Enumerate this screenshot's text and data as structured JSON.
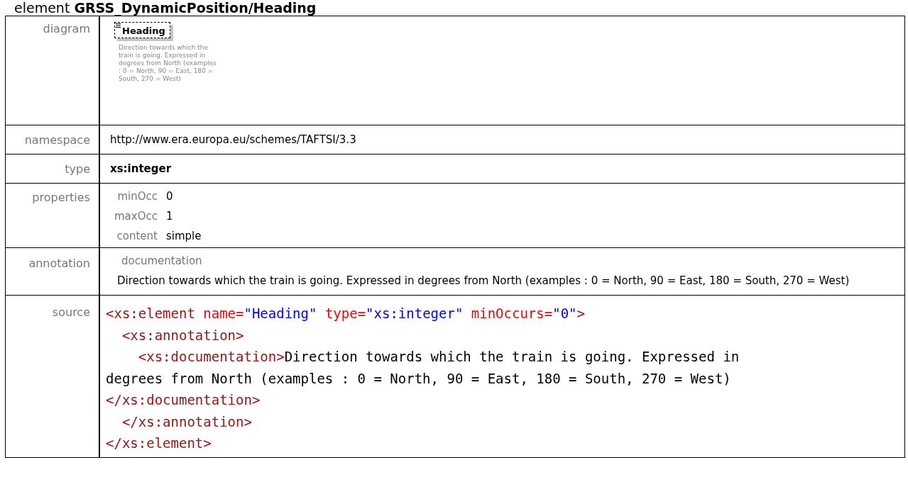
{
  "title": "element **GRSS_DynamicPosition/Heading**",
  "rows": [
    {
      "kind": "diagram",
      "label": "diagram",
      "element_name": "Heading",
      "description": "Direction towards which the train is going. Expressed in degrees from North (examples : 0 = North, 90 = East, 180 = South, 270 = West)"
    },
    {
      "kind": "text",
      "label": "namespace",
      "value": "http://www.era.europa.eu/schemes/TAFTSI/3.3"
    },
    {
      "kind": "bold",
      "label": "type",
      "value": "xs:integer"
    },
    {
      "kind": "properties",
      "label": "properties",
      "items": [
        {
          "name": "minOcc",
          "value": "0"
        },
        {
          "name": "maxOcc",
          "value": "1"
        },
        {
          "name": "content",
          "value": "simple"
        }
      ]
    },
    {
      "kind": "annotation",
      "label": "annotation",
      "heading": "documentation",
      "text": "Direction towards which the train is going. Expressed in degrees from North (examples : 0 = North, 90 = East, 180 = South, 270 = West)"
    },
    {
      "kind": "source",
      "label": "source",
      "lines": [
        {
          "open": [
            {
              "kind": "tag",
              "text": "<xs:element "
            },
            {
              "kind": "attr",
              "text": "name="
            },
            {
              "kind": "value",
              "text": "\"Heading\" "
            },
            {
              "kind": "attr",
              "text": "type="
            },
            {
              "kind": "value",
              "text": "\"xs:integer\" "
            },
            {
              "kind": "attr",
              "text": "minOccurs="
            },
            {
              "kind": "value",
              "text": "\"0\""
            },
            {
              "kind": "tag",
              "text": ">"
            }
          ],
          "children": [
            {
              "open": [
                {
                  "kind": "tag",
                  "text": "<xs:annotation>"
                }
              ],
              "children": [
                {
                  "open": [
                    {
                      "kind": "tag",
                      "text": "<xs:documentation>"
                    },
                    {
                      "kind": "text",
                      "text": "Direction towards which the train is going. Expressed in degrees from North (examples : 0 = North, 90 = East, 180 = South, 270 = West)"
                    },
                    {
                      "kind": "tag",
                      "text": "</xs:documentation>"
                    }
                  ]
                }
              ],
              "close": [
                {
                  "kind": "tag",
                  "text": "</xs:annotation>"
                }
              ]
            }
          ],
          "close": [
            {
              "kind": "tag",
              "text": "</xs:element>"
            }
          ]
        }
      ]
    }
  ]
}
